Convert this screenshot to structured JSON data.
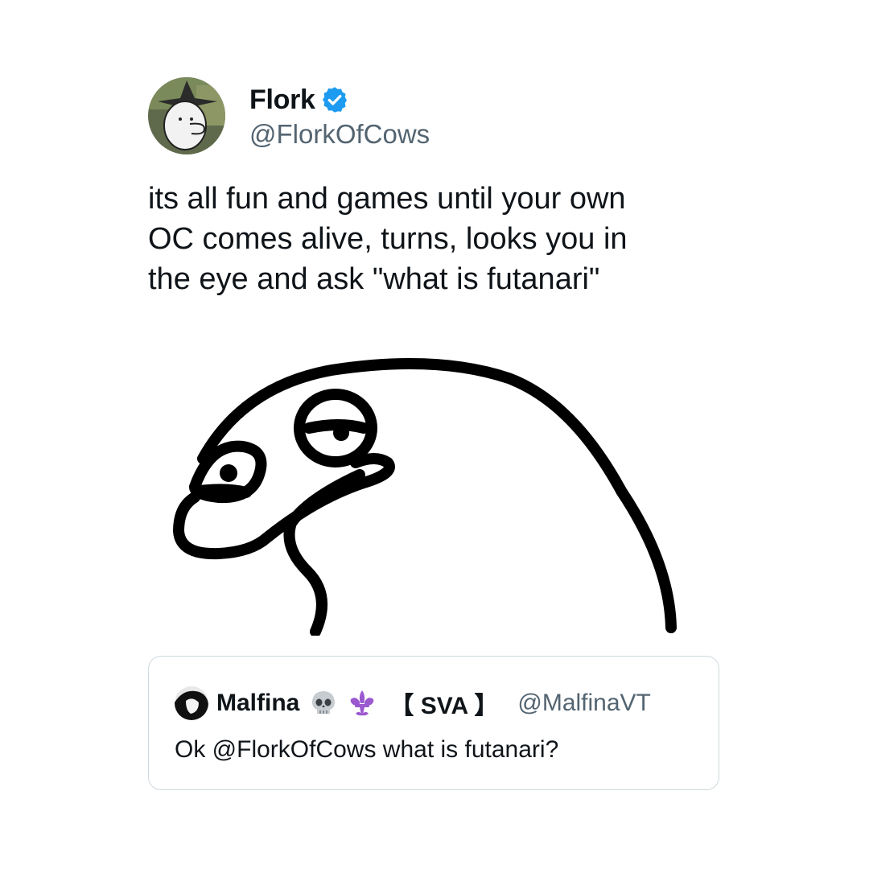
{
  "tweet": {
    "author": {
      "display_name": "Flork",
      "handle": "@FlorkOfCows",
      "verified": true,
      "avatar_icon": "flork-witch-hat-avatar",
      "verified_color": "#1d9bf0"
    },
    "text": "its all fun and games until your own\nOC comes alive, turns, looks you in\nthe eye and ask \"what is futanari\"",
    "media_icon": "flork-character-drawing"
  },
  "quote": {
    "author": {
      "display_name": "Malfina",
      "emojis": [
        "skull-emoji",
        "fleur-de-lis-emoji"
      ],
      "tag": "【 SVA 】",
      "handle": "@MalfinaVT",
      "avatar_icon": "malfina-avatar"
    },
    "text": "Ok @FlorkOfCows what is futanari?"
  },
  "colors": {
    "text": "#0f1419",
    "secondary": "#536471",
    "border": "#cfd9de",
    "accent": "#1d9bf0"
  }
}
